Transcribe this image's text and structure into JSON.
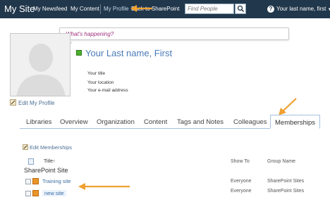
{
  "topbar": {
    "site_title": "My Site",
    "nav_newsfeed": "My Newsfeed",
    "nav_content": "My Content",
    "nav_profile": "My Profile",
    "nav_back": "Back to SharePoint",
    "search_placeholder": "Find People",
    "user_menu": "Your last name, first",
    "help": "?"
  },
  "status": {
    "placeholder": "What's happening?"
  },
  "profile": {
    "name": "Your Last name, First",
    "title": "Your title",
    "location": "Your location",
    "email": "Your e-mail address",
    "edit_link": "Edit My Profile"
  },
  "tabs": [
    {
      "label": "Libraries",
      "active": false
    },
    {
      "label": "Overview",
      "active": false
    },
    {
      "label": "Organization",
      "active": false
    },
    {
      "label": "Content",
      "active": false
    },
    {
      "label": "Tags and Notes",
      "active": false
    },
    {
      "label": "Colleagues",
      "active": false
    },
    {
      "label": "Memberships",
      "active": true
    }
  ],
  "memberships": {
    "edit_link": "Edit Memberships",
    "columns": {
      "title": "Title",
      "sort_indicator": "↑",
      "show_to": "Show To",
      "group_name": "Group Name"
    },
    "section": "SharePoint Site",
    "rows": [
      {
        "title": "Training site",
        "show_to": "Everyone",
        "group": "SharePoint Sites"
      },
      {
        "title": "new site",
        "show_to": "Everyone",
        "group": "SharePoint Sites"
      }
    ]
  },
  "colors": {
    "topbar_bg": "#21374c",
    "accent_orange": "#f0a030",
    "link_blue": "#4a7bb7",
    "status_magenta": "#a0307e"
  }
}
